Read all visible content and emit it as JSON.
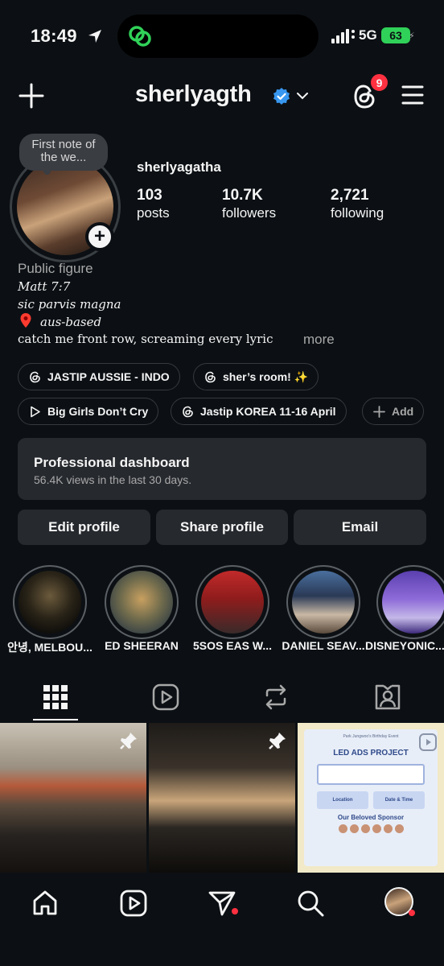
{
  "status_bar": {
    "time": "18:49",
    "network": "5G",
    "battery": "63"
  },
  "header": {
    "username": "sherlyagth",
    "threads_badge": "9"
  },
  "profile": {
    "note": "First note of the we...",
    "name": "sherlyagatha",
    "stats": [
      {
        "value": "103",
        "label": "posts"
      },
      {
        "value": "10.7K",
        "label": "followers"
      },
      {
        "value": "2,721",
        "label": "following"
      }
    ],
    "category": "Public figure",
    "bio_lines": [
      "Matt 7:7",
      "sic parvis magna",
      "aus-based"
    ],
    "bio_last": "catch me front row, screaming every lyric",
    "more": "more"
  },
  "chips": [
    {
      "label": "JASTIP AUSSIE - INDO",
      "icon": "threads-icon"
    },
    {
      "label": "sher’s room! ✨",
      "icon": "threads-icon"
    },
    {
      "label": "Big Girls Don’t Cry",
      "icon": "play-icon"
    },
    {
      "label": "Jastip KOREA 11-16 April",
      "icon": "threads-icon"
    },
    {
      "label": "Add",
      "icon": "plus-icon"
    }
  ],
  "dashboard": {
    "title": "Professional dashboard",
    "subtitle": "56.4K views in the last 30 days."
  },
  "buttons": {
    "edit": "Edit profile",
    "share": "Share profile",
    "email": "Email"
  },
  "highlights": [
    {
      "label": "안녕, MELBOU..."
    },
    {
      "label": "ED SHEERAN"
    },
    {
      "label": "5SOS EAS W..."
    },
    {
      "label": "DANIEL SEAV..."
    },
    {
      "label": "DISNEYONIC..."
    }
  ],
  "grid": {
    "flyer_header": "Park Jungwoo's Birthday Event",
    "flyer_title": "LED ADS PROJECT",
    "flyer_location": "Location",
    "flyer_datetime": "Date & Time",
    "flyer_sponsor": "Our Beloved Sponsor"
  },
  "colors": {
    "accent_red": "#ff3040",
    "verified_blue": "#3897f0",
    "battery_green": "#30d158"
  }
}
